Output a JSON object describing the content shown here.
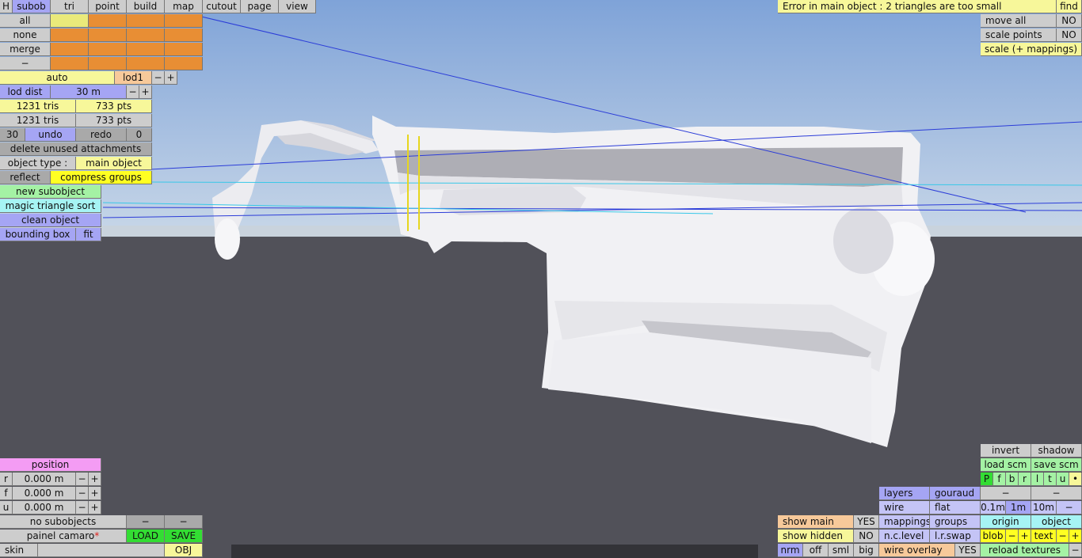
{
  "toolbar": {
    "items": [
      "H",
      "subob",
      "tri",
      "point",
      "build",
      "map",
      "cutout",
      "page",
      "view"
    ]
  },
  "error": {
    "message": "Error in main object : 2 triangles are too small",
    "find": "find"
  },
  "right_top": {
    "move_all": "move all",
    "move_all_val": "NO",
    "scale_points": "scale points",
    "scale_points_val": "NO",
    "scale_mappings": "scale (+ mappings)"
  },
  "select": {
    "all": "all",
    "none": "none",
    "merge": "merge",
    "minus": "−"
  },
  "lod": {
    "auto": "auto",
    "lod1": "lod1",
    "minus": "−",
    "plus": "+",
    "dist_label": "lod dist",
    "dist_value": "30 m",
    "tris1": "1231 tris",
    "pts1": "733 pts",
    "tris2": "1231 tris",
    "pts2": "733 pts"
  },
  "history": {
    "count": "30",
    "undo": "undo",
    "redo": "redo",
    "redo_count": "0"
  },
  "actions": {
    "delete_unused": "delete unused attachments",
    "object_type_label": "object type :",
    "object_type_value": "main object",
    "reflect": "reflect",
    "compress_groups": "compress groups",
    "new_subobject": "new subobject",
    "magic_sort": "magic triangle sort",
    "clean_object": "clean object",
    "bounding_box": "bounding box",
    "fit": "fit"
  },
  "position": {
    "title": "position",
    "rows": [
      {
        "axis": "r",
        "value": "0.000 m"
      },
      {
        "axis": "f",
        "value": "0.000 m"
      },
      {
        "axis": "u",
        "value": "0.000 m"
      }
    ],
    "minus": "−",
    "plus": "+"
  },
  "subobjects": {
    "status": "no subobjects",
    "minus": "−",
    "file": "painel camaro",
    "modified_mark": "*",
    "load": "LOAD",
    "save": "SAVE",
    "skin": "skin",
    "obj": "OBJ"
  },
  "view_opts": {
    "show_main": "show main",
    "show_main_val": "YES",
    "show_hidden": "show hidden",
    "show_hidden_val": "NO",
    "nrm": "nrm",
    "off": "off",
    "sml": "sml",
    "big": "big"
  },
  "render": {
    "layers": "layers",
    "gouraud": "gouraud",
    "wire": "wire",
    "flat": "flat",
    "mappings": "mappings",
    "groups": "groups",
    "nc_level": "n.c.level",
    "lr_swap": "l.r.swap",
    "wire_overlay": "wire overlay",
    "wire_overlay_val": "YES"
  },
  "right_bottom": {
    "invert": "invert",
    "shadow": "shadow",
    "load_scm": "load scm",
    "save_scm": "save scm",
    "letters": [
      "P",
      "f",
      "b",
      "r",
      "l",
      "t",
      "u",
      "•"
    ],
    "minus": "−",
    "grid": [
      "0.1m",
      "1m",
      "10m"
    ],
    "origin": "origin",
    "object": "object",
    "blob": "blob",
    "text": "text",
    "plus": "+",
    "reload_textures": "reload textures"
  },
  "colors": {
    "sky_top": "#7fa3d8",
    "sky_bottom": "#c6d6e8",
    "ground": "#515159",
    "model": "#f2f2f5"
  }
}
